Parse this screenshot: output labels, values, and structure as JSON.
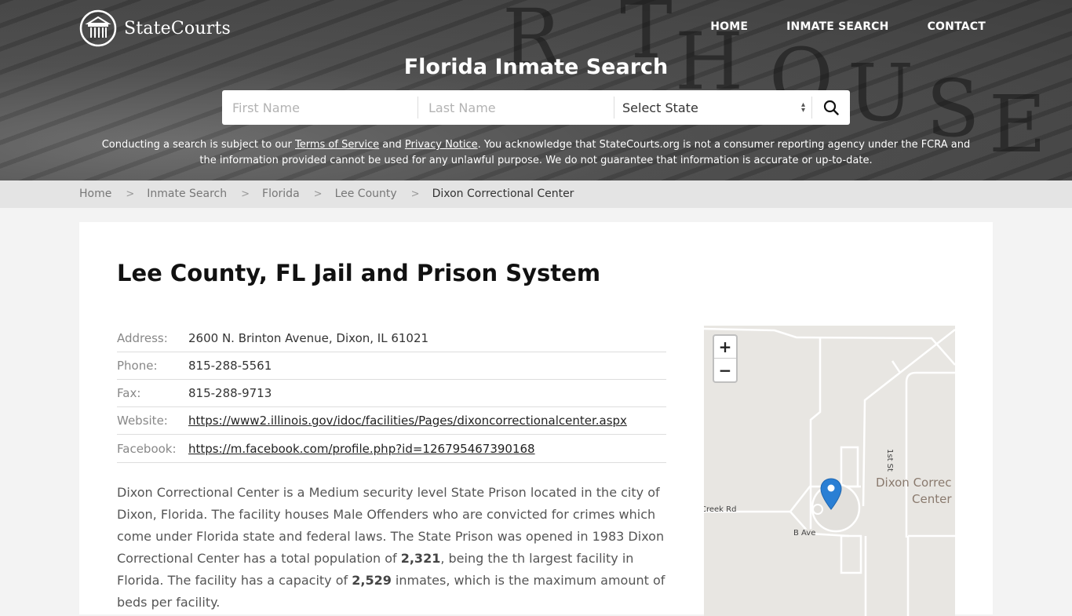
{
  "header": {
    "logo_text": "StateCourts",
    "nav": [
      {
        "label": "HOME"
      },
      {
        "label": "INMATE SEARCH"
      },
      {
        "label": "CONTACT"
      }
    ],
    "title": "Florida Inmate Search",
    "search": {
      "first_name_placeholder": "First Name",
      "last_name_placeholder": "Last Name",
      "state_select_value": "Select State",
      "search_icon": "search-icon"
    },
    "disclaimer": {
      "part1": "Conducting a search is subject to our ",
      "terms_link": "Terms of Service",
      "part2": " and ",
      "privacy_link": "Privacy Notice",
      "part3": ". You acknowledge that StateCourts.org is not a consumer reporting agency under the FCRA and the information provided cannot be used for any unlawful purpose. We do not guarantee that information is accurate or up-to-date."
    }
  },
  "breadcrumb": [
    {
      "label": "Home"
    },
    {
      "label": "Inmate Search"
    },
    {
      "label": "Florida"
    },
    {
      "label": "Lee County"
    },
    {
      "label": "Dixon Correctional Center"
    }
  ],
  "main": {
    "title": "Lee County, FL Jail and Prison System",
    "info": [
      {
        "label": "Address:",
        "value": "2600 N. Brinton Avenue, Dixon, IL 61021"
      },
      {
        "label": "Phone:",
        "value": "815-288-5561"
      },
      {
        "label": "Fax:",
        "value": "815-288-9713"
      },
      {
        "label": "Website:",
        "value": "https://www2.illinois.gov/idoc/facilities/Pages/dixoncorrectionalcenter.aspx"
      },
      {
        "label": "Facebook:",
        "value": "https://m.facebook.com/profile.php?id=126795467390168"
      }
    ],
    "description": {
      "part1": "Dixon Correctional Center is a Medium security level State Prison located in the city of Dixon, Florida. The facility houses Male Offenders who are convicted for crimes which come under Florida state and federal laws. The State Prison was opened in 1983 Dixon Correctional Center has a total population of ",
      "population": "2,321",
      "part2": ", being the th largest facility in Florida. The facility has a capacity of ",
      "capacity": "2,529",
      "part3": " inmates, which is the maximum amount of beds per facility."
    }
  },
  "map": {
    "zoom_in": "+",
    "zoom_out": "−",
    "labels": {
      "street_1st": "1st St",
      "creek_rd": "Creek Rd",
      "b_ave": "B Ave",
      "poi_line1": "Dixon Correc",
      "poi_line2": "Center"
    },
    "pin_color": "#2a7fd4"
  }
}
